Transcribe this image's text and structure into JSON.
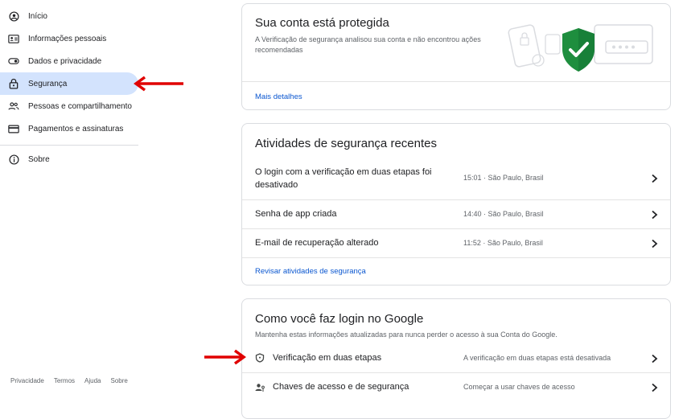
{
  "sidebar": {
    "items": [
      {
        "label": "Início",
        "icon": "home-icon"
      },
      {
        "label": "Informações pessoais",
        "icon": "id-card-icon"
      },
      {
        "label": "Dados e privacidade",
        "icon": "toggle-icon"
      },
      {
        "label": "Segurança",
        "icon": "lock-icon",
        "active": true
      },
      {
        "label": "Pessoas e compartilhamento",
        "icon": "people-icon"
      },
      {
        "label": "Pagamentos e assinaturas",
        "icon": "credit-card-icon"
      },
      {
        "label": "Sobre",
        "icon": "info-icon"
      }
    ],
    "footer": [
      "Privacidade",
      "Termos",
      "Ajuda",
      "Sobre"
    ]
  },
  "protected_card": {
    "title": "Sua conta está protegida",
    "desc": "A Verificação de segurança analisou sua conta e não encontrou ações recomendadas",
    "link": "Mais detalhes"
  },
  "activity_card": {
    "title": "Atividades de segurança recentes",
    "rows": [
      {
        "label": "O login com a verificação em duas etapas foi desativado",
        "meta": "15:01 · São Paulo, Brasil"
      },
      {
        "label": "Senha de app criada",
        "meta": "14:40 · São Paulo, Brasil"
      },
      {
        "label": "E-mail de recuperação alterado",
        "meta": "11:52 · São Paulo, Brasil"
      }
    ],
    "link": "Revisar atividades de segurança"
  },
  "login_card": {
    "title": "Como você faz login no Google",
    "desc": "Mantenha estas informações atualizadas para nunca perder o acesso à sua Conta do Google.",
    "rows": [
      {
        "label": "Verificação em duas etapas",
        "meta": "A verificação em duas etapas está desativada",
        "icon": "shield-icon"
      },
      {
        "label": "Chaves de acesso e de segurança",
        "meta": "Começar a usar chaves de acesso",
        "icon": "passkey-icon"
      }
    ]
  },
  "colors": {
    "accent": "#0b57d0",
    "active_bg": "#d3e3fd",
    "annotation_arrow": "#e00000",
    "shield": "#1e8e3e"
  }
}
